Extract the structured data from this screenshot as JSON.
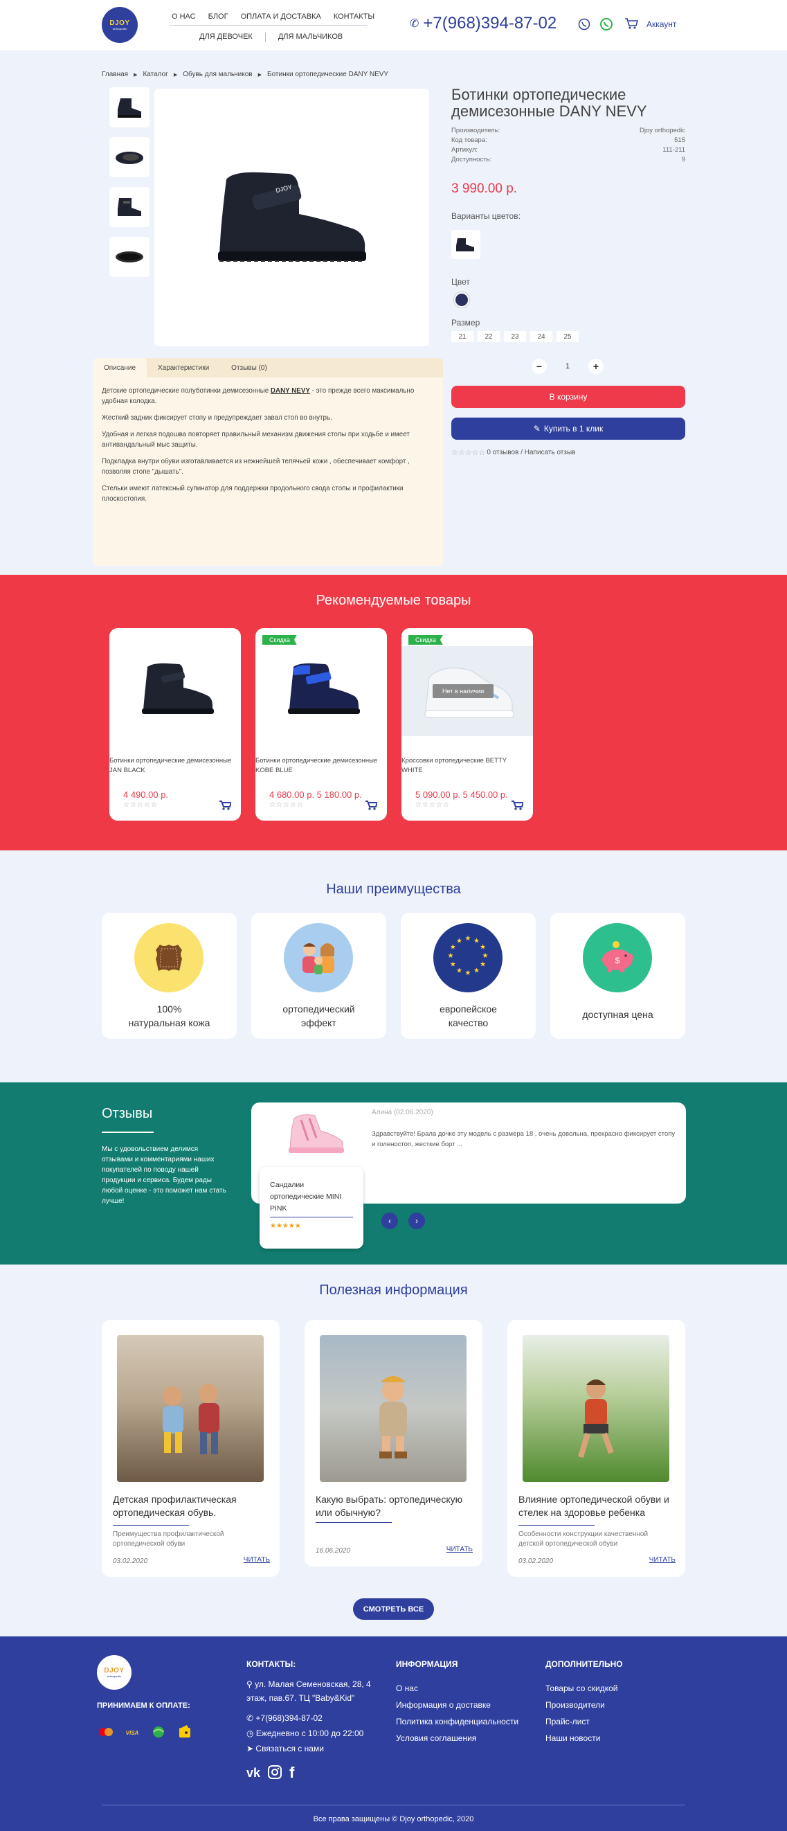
{
  "header": {
    "logo_text": "DJOY",
    "logo_sub": "orthopedic",
    "nav_top": [
      "О НАС",
      "БЛОГ",
      "ОПЛАТА И ДОСТАВКА",
      "КОНТАКТЫ"
    ],
    "nav_bottom": [
      "ДЛЯ ДЕВОЧЕК",
      "ДЛЯ МАЛЬЧИКОВ"
    ],
    "phone": "+7(968)394-87-02",
    "account": "Аккаунт"
  },
  "breadcrumb": [
    "Главная",
    "Каталог",
    "Обувь для мальчиков",
    "Ботинки ортопедические DANY NEVY"
  ],
  "product": {
    "title": "Ботинки ортопедические демисезонные DANY NEVY",
    "specs": [
      {
        "label": "Производитель:",
        "value": "Djoy orthopedic"
      },
      {
        "label": "Код товара:",
        "value": "515"
      },
      {
        "label": "Артикул:",
        "value": "111-211"
      },
      {
        "label": "Доступность:",
        "value": "9"
      }
    ],
    "price": "3 990.00 р.",
    "variants_label": "Варианты цветов:",
    "color_label": "Цвет",
    "size_label": "Размер",
    "sizes": [
      "21",
      "22",
      "23",
      "24",
      "25"
    ],
    "qty": "1",
    "cart_button": "В корзину",
    "buy_button": "Купить в 1 клик",
    "rating_text": "0 отзывов / Написать отзыв",
    "colors": {
      "accent": "#2e3f9e",
      "price": "#e8394a",
      "color_swatch": "#2a3160"
    }
  },
  "tabs": {
    "items": [
      "Описание",
      "Характеристики",
      "Отзывы (0)"
    ],
    "desc": {
      "p1_a": "Детские ортопедические полуботинки демисезонные",
      "p1_link": "DANY NEVY",
      "p1_b": "- это прежде всего максимально удобная колодка.",
      "p2": "Жесткий задник фиксирует стопу и предупреждает завал стоп во внутрь.",
      "p3": "Удобная и легкая подошва повторяет правильный механизм движения стопы при ходьбе и имеет антивандальный мыс защиты.",
      "p4": "Подкладка внутри обуви изготавливается из нежнейшей телячьей кожи , обеспечивает комфорт , позволяя стопе \"дышать\".",
      "p5": "Стельки имеют латексный супинатор для поддержки продольного свода стопы и профилактики плоскостопия."
    }
  },
  "recommended": {
    "title": "Рекомендуемые товары",
    "items": [
      {
        "name": "Ботинки ортопедические демисезонные JAN BLACK",
        "price": "4 490.00 р.",
        "badge": "",
        "stock": ""
      },
      {
        "name": "Ботинки ортопедические демисезонные KOBE BLUE",
        "price": "4 680.00 р. 5 180.00 р.",
        "badge": "Скидка",
        "stock": ""
      },
      {
        "name": "Кроссовки ортопедические BETTY WHITE",
        "price": "5 090.00 р. 5 450.00 р.",
        "badge": "Скидка",
        "stock": "Нет в наличии"
      }
    ]
  },
  "advantages": {
    "title": "Наши преимущества",
    "items": [
      {
        "line1": "100%",
        "line2": "натуральная кожа"
      },
      {
        "line1": "ортопедический",
        "line2": "эффект"
      },
      {
        "line1": "европейское",
        "line2": "качество"
      },
      {
        "line1": "доступная цена",
        "line2": ""
      }
    ]
  },
  "reviews": {
    "title": "Отзывы",
    "text": "Мы с удовольствием делимся отзывами и комментариями наших покупателей по поводу нашей продукции и сервиса. Будем рады любой оценке - это поможет нам стать лучше!",
    "author": "Алина (02.06.2020)",
    "body": "Здравствуйте! Брала дочке эту модель с размера 18 , очень довольна, прекрасно фиксирует стопу и голеностоп, жесткие борт ...",
    "product": "Сандалии ортопедические MINI PINK",
    "stars": "★★★★★"
  },
  "info": {
    "title": "Полезная информация",
    "items": [
      {
        "title": "Детская профилактическая ортопедическая обувь.",
        "excerpt": "Преимущества профилактической ортопедической обуви",
        "date": "03.02.2020",
        "read": "ЧИТАТЬ"
      },
      {
        "title": "Какую выбрать: ортопедическую или обычную?",
        "excerpt": "",
        "date": "16.06.2020",
        "read": "ЧИТАТЬ"
      },
      {
        "title": "Влияние ортопедической обуви и стелек на здоровье ребенка",
        "excerpt": "Особенности конструкции качественной детской ортопедической обуви",
        "date": "03.02.2020",
        "read": "ЧИТАТЬ"
      }
    ],
    "all_button": "СМОТРЕТЬ ВСЕ"
  },
  "footer": {
    "payment_label": "ПРИНИМАЕМ К ОПЛАТЕ:",
    "contacts_title": "КОНТАКТЫ:",
    "address": "ул. Малая Семеновская, 28, 4 этаж, пав.67. ТЦ \"Baby&Kid\"",
    "phone": "+7(968)394-87-02",
    "hours": "Ежедневно с 10:00 до 22:00",
    "contact_link": "Связаться с нами",
    "info_title": "ИНФОРМАЦИЯ",
    "info_links": [
      "О нас",
      "Информация о доставке",
      "Политика конфиденциальности",
      "Условия соглашения"
    ],
    "extra_title": "ДОПОЛНИТЕЛЬНО",
    "extra_links": [
      "Товары со скидкой",
      "Производители",
      "Прайс-лист",
      "Наши новости"
    ],
    "copyright": "Все права защищены © Djoy orthopedic, 2020"
  }
}
